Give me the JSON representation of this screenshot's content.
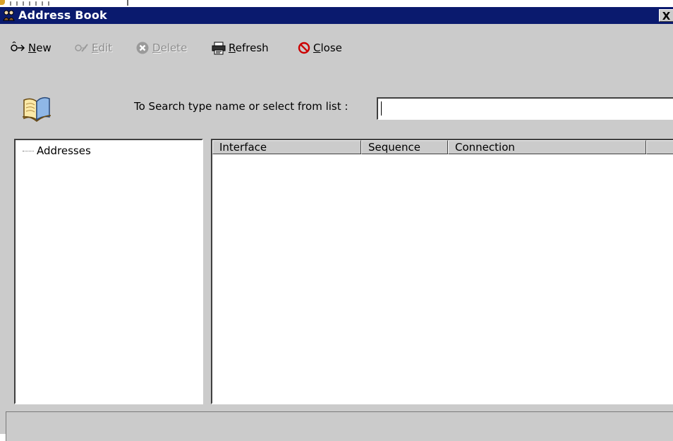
{
  "window": {
    "title": "Address Book",
    "close_glyph": "X"
  },
  "toolbar": {
    "buttons": [
      {
        "pre": "",
        "accel": "N",
        "post": "ew",
        "icon": "new-icon",
        "enabled": true
      },
      {
        "pre": "",
        "accel": "E",
        "post": "dit",
        "icon": "edit-icon",
        "enabled": false
      },
      {
        "pre": "",
        "accel": "D",
        "post": "elete",
        "icon": "delete-icon",
        "enabled": false
      },
      {
        "pre": "",
        "accel": "R",
        "post": "efresh",
        "icon": "refresh-icon",
        "enabled": true
      },
      {
        "pre": "",
        "accel": "C",
        "post": "lose",
        "icon": "close-icon",
        "enabled": true
      }
    ]
  },
  "search": {
    "label": "To Search type name or select from list :",
    "value": ""
  },
  "tree": {
    "items": [
      {
        "label": "Addresses"
      }
    ]
  },
  "list": {
    "columns": [
      "Interface",
      "Sequence",
      "Connection",
      ""
    ],
    "rows": []
  },
  "colors": {
    "titlebar": "#0a1a6e",
    "face": "#cbcbcb",
    "window_bg": "#ffffff",
    "disabled_text": "#8d8d8d",
    "close_red": "#cc0000"
  }
}
